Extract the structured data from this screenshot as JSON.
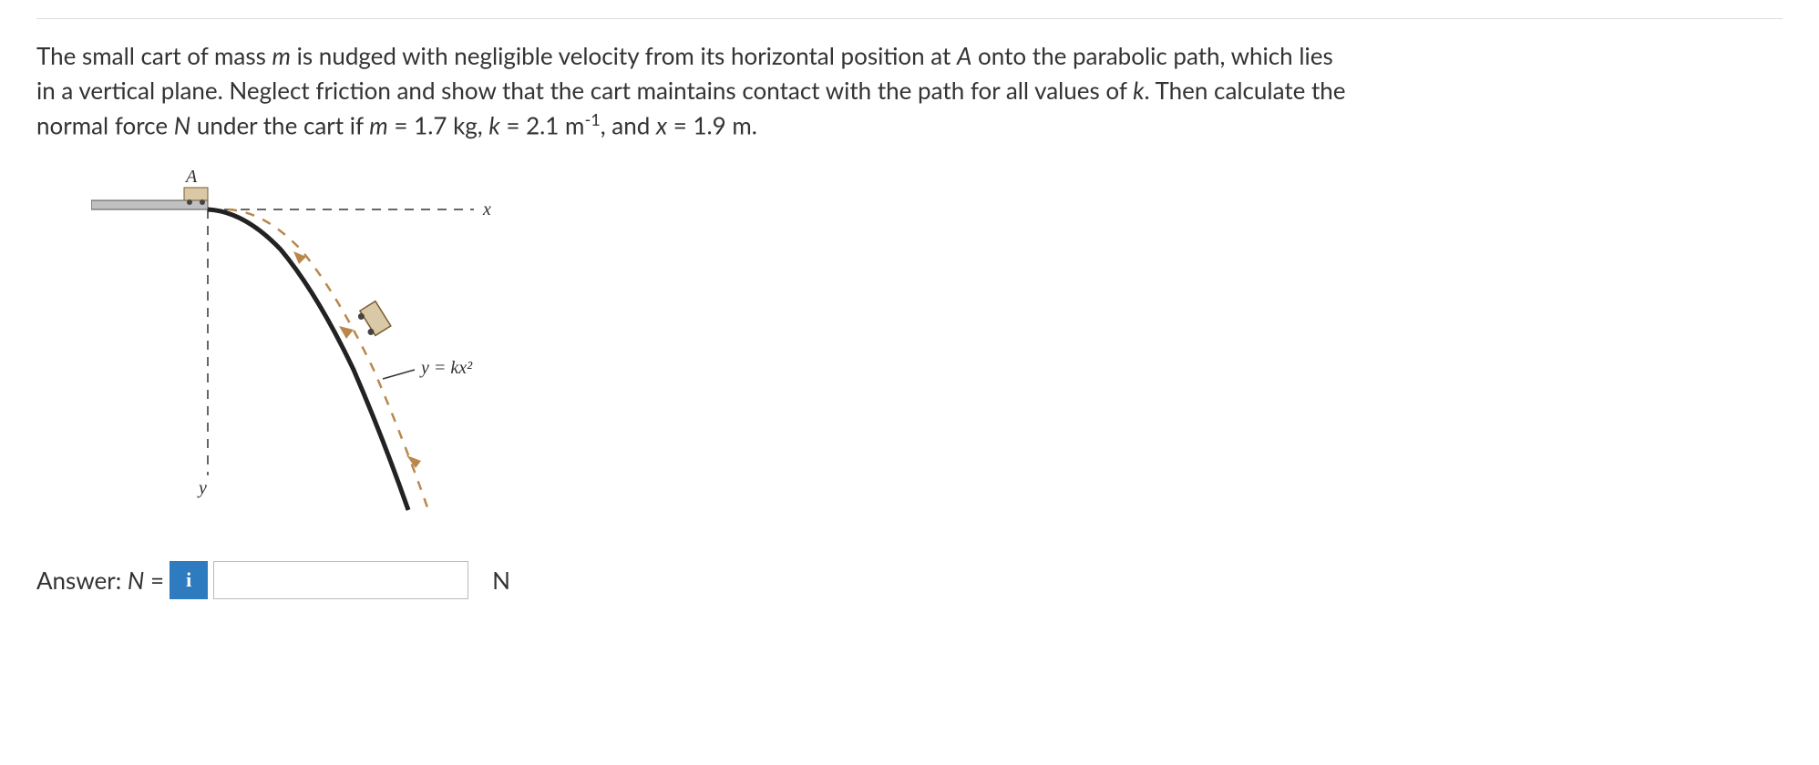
{
  "problem": {
    "text_html": "The small cart of mass <i>m</i> is nudged with negligible velocity from its horizontal position at <i>A</i> onto the parabolic path, which lies in a vertical plane. Neglect friction and show that the cart maintains contact with the path for all values of <i>k</i>. Then calculate the normal force <i>N</i> under the cart if <i>m</i> = 1.7 kg, <i>k</i> = 2.1 m<sup>-1</sup>, and <i>x</i> = 1.9 m."
  },
  "figure": {
    "point_A_label": "A",
    "x_axis_label": "x",
    "y_axis_label": "y",
    "curve_label": "y = kx²"
  },
  "answer": {
    "label_html": "Answer: <i>N</i> =",
    "info_icon": "i",
    "input_value": "",
    "unit": "N"
  }
}
